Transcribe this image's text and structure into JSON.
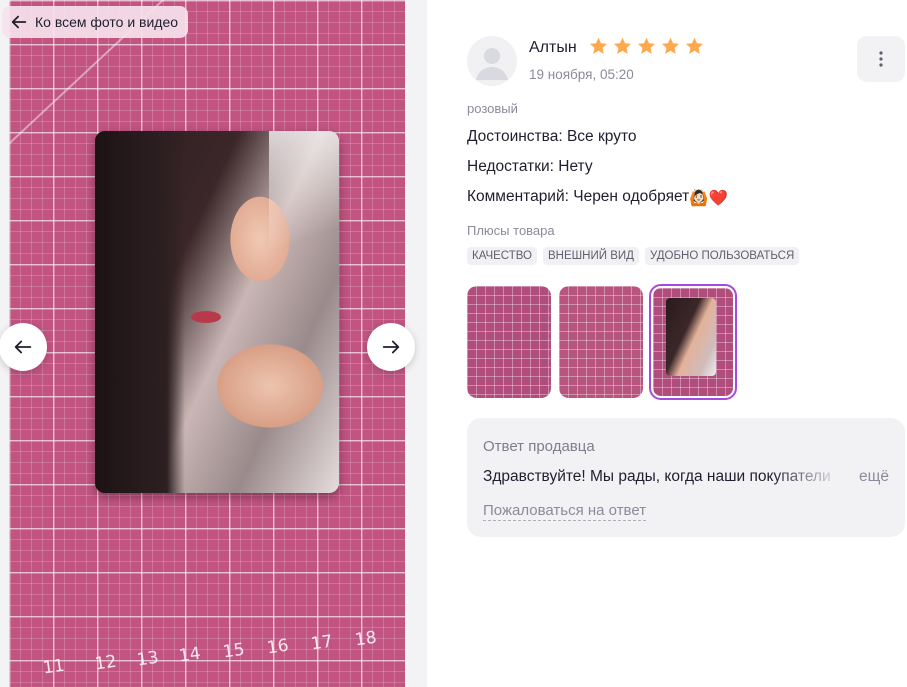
{
  "viewer": {
    "back_label": "Ко всем фото и видео",
    "ruler_numbers": [
      "11",
      "12",
      "13",
      "14",
      "15",
      "16",
      "17",
      "18"
    ]
  },
  "review": {
    "author": "Алтын",
    "rating": 5,
    "date": "19 ноября, 05:20",
    "variant": "розовый",
    "pros_line": "Достоинства: Все круто",
    "cons_line": "Недостатки: Нету",
    "comment_line": "Комментарий: Черен одобряет",
    "comment_emoji": "🙆🏻❤️",
    "pros_title": "Плюсы товара",
    "tags": [
      "КАЧЕСТВО",
      "ВНЕШНИЙ ВИД",
      "УДОБНО ПОЛЬЗОВАТЬСЯ"
    ],
    "thumbnails_count": 3,
    "selected_thumbnail": 3
  },
  "seller_answer": {
    "title": "Ответ продавца",
    "text": "Здравствуйте! Мы рады, когда наши покупатели",
    "more_label": "ещё",
    "complain_label": "Пожаловаться на ответ"
  },
  "colors": {
    "star": "#ffa94d",
    "selected_thumb": "#a54ae0",
    "mat": "#c25482"
  },
  "icons": [
    "arrow-left-icon",
    "arrow-right-icon",
    "star-icon",
    "more-vertical-icon",
    "avatar-placeholder-icon"
  ]
}
